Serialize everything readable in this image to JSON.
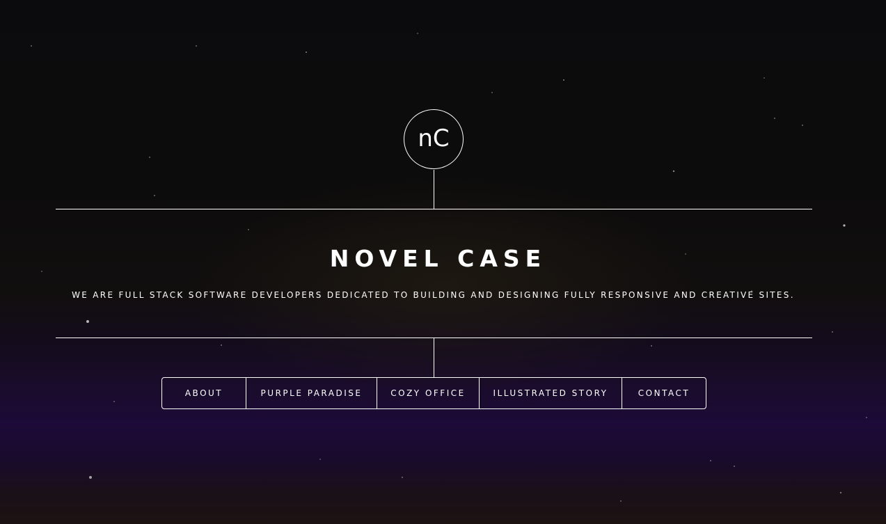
{
  "brand": {
    "logo_text": "nC",
    "title": "NOVEL CASE",
    "tagline": "WE ARE FULL STACK SOFTWARE DEVELOPERS DEDICATED TO BUILDING AND DESIGNING FULLY RESPONSIVE AND CREATIVE SITES."
  },
  "nav": {
    "items": [
      {
        "label": "ABOUT"
      },
      {
        "label": "PURPLE PARADISE"
      },
      {
        "label": "COZY OFFICE"
      },
      {
        "label": "ILLUSTRATED STORY"
      },
      {
        "label": "CONTACT"
      }
    ]
  },
  "colors": {
    "text": "#ffffff",
    "background_top": "#0b0b0d",
    "background_purple": "#1d0a38"
  }
}
